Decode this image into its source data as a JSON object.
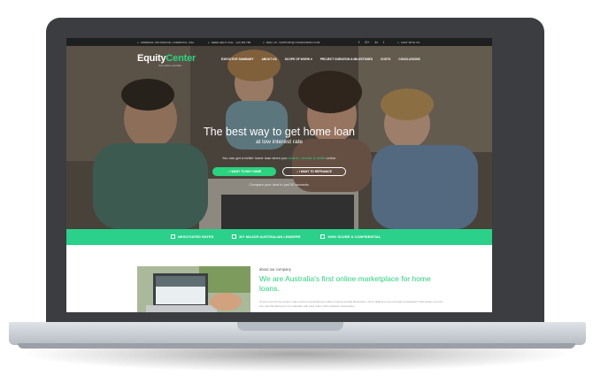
{
  "topbar": {
    "address": "ADDRESS: 245 AVENUE, LIVERPOOL, USA",
    "helpline": "NEED HELP CALL : 123 456 789",
    "mail": "MAIL US : SUPPORT@YOURDOMAIN.COM",
    "social": [
      "f",
      "G+",
      "in",
      "t"
    ],
    "chat": "CHAT WITH US"
  },
  "nav": {
    "logo_main": "Equity",
    "logo_accent": "Center",
    "logo_sub": "home loans in australia",
    "items": [
      "EXECUTIVE SUMMARY",
      "ABOUT US",
      "SCOPE OF WORK ▾",
      "PROJECT DURATION & MILESTONES",
      "COSTS",
      "CONCLUSIONS"
    ]
  },
  "hero": {
    "title": "The best way to get home loan",
    "subtitle": "at low interest rate",
    "desc_before": "You can get a better home loan when you",
    "desc_highlight": "search, choose & settle",
    "desc_after": "online.",
    "btn_buy": "I WANT TO BUY HOME",
    "btn_refinance": "I WANT TO REFINANCE",
    "compare": "Compare your deal in just 30 seconds."
  },
  "features": [
    "NEGOTIATED RATES",
    "30+ MAJOR AUSTRALIAN LENDERS",
    "100% SCURE & CONFIDENTIAL"
  ],
  "about": {
    "label": "about our company",
    "title": "We are Australia's first online marketplace for home loans.",
    "text": "Ut enim ad minima veniam, quis nostrum exercitationem ullam corporis suscipit laboriosam, nisi ut aliquid ex ea commodi consequatur? Quis autem vel eum iure reprehenderit qui in ea voluptate velit esse quam nihil molestiae consequatur."
  },
  "colors": {
    "accent": "#2bd27f",
    "bezel": "#3b3d40",
    "topbar": "#1f1f1f"
  }
}
